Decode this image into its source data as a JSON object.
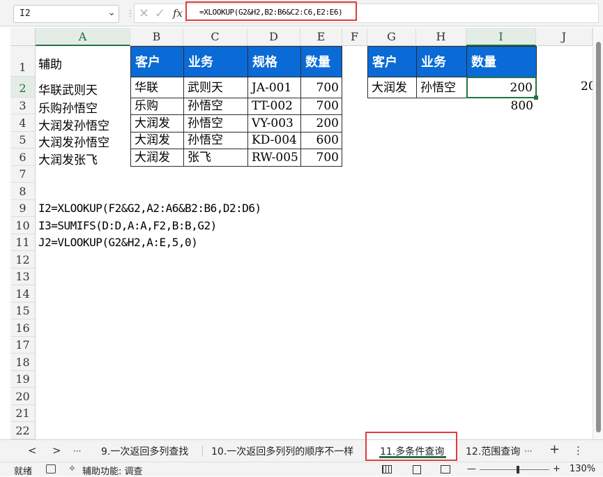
{
  "formula_bar": {
    "name_box": "I2",
    "fx_label": "fx",
    "formula": "=XLOOKUP(G2&H2,B2:B6&C2:C6,E2:E6)",
    "cancel_glyph": "✕",
    "confirm_glyph": "✓"
  },
  "columns": [
    "A",
    "B",
    "C",
    "D",
    "E",
    "F",
    "G",
    "H",
    "I",
    "J"
  ],
  "rows": [
    "1",
    "2",
    "3",
    "4",
    "5",
    "6",
    "7",
    "8",
    "9",
    "10",
    "11",
    "12",
    "13",
    "14",
    "15",
    "16",
    "17",
    "18",
    "19",
    "20",
    "21",
    "22"
  ],
  "cells": {
    "A1": "辅助",
    "A2": "华联武则天",
    "A3": "乐购孙悟空",
    "A4": "大润发孙悟空",
    "A5": "大润发孙悟空",
    "A6": "大润发张飞",
    "headers": {
      "B1": "客户",
      "C1": "业务",
      "D1": "规格",
      "E1": "数量",
      "G1": "客户",
      "H1": "业务",
      "I1": "数量"
    },
    "table": [
      {
        "B": "华联",
        "C": "武则天",
        "D": "JA-001",
        "E": "700"
      },
      {
        "B": "乐购",
        "C": "孙悟空",
        "D": "TT-002",
        "E": "700"
      },
      {
        "B": "大润发",
        "C": "孙悟空",
        "D": "VY-003",
        "E": "200"
      },
      {
        "B": "大润发",
        "C": "孙悟空",
        "D": "KD-004",
        "E": "600"
      },
      {
        "B": "大润发",
        "C": "张飞",
        "D": "RW-005",
        "E": "700"
      }
    ],
    "G2": "大润发",
    "H2": "孙悟空",
    "I2": "200",
    "I3": "800",
    "J2": "20",
    "A9": "I2=XLOOKUP(F2&G2,A2:A6&B2:B6,D2:D6)",
    "A10": "I3=SUMIFS(D:D,A:A,F2,B:B,G2)",
    "A11": "J2=VLOOKUP(G2&H2,A:E,5,0)"
  },
  "sheet_tabs": {
    "prev": "<",
    "next": ">",
    "more_left": "···",
    "tabs": [
      "9.一次返回多列查找",
      "10.一次返回多列列的顺序不一样",
      "11.多条件查询",
      "12.范围查询"
    ],
    "active_index": 2,
    "more_right": "···",
    "add": "+",
    "options": "⋮"
  },
  "status_bar": {
    "ready": "就绪",
    "accessibility": "辅助功能: 调查",
    "zoom_minus": "—",
    "zoom_plus": "+",
    "zoom": "130%",
    "zoom_level_fraction": 0.55
  }
}
